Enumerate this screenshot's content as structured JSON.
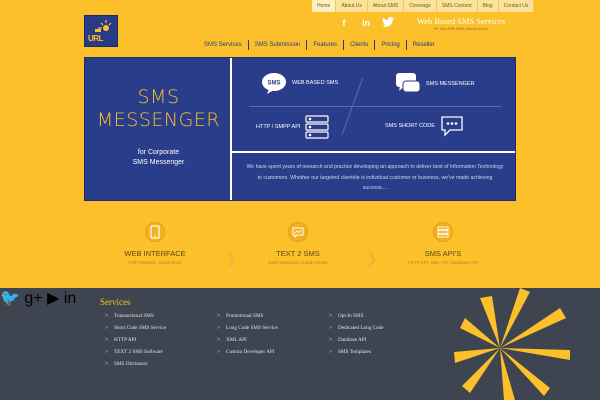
{
  "top_nav": [
    "Home",
    "About Us",
    "About SMS",
    "Coverage",
    "SMS Content",
    "Blog",
    "Contact Us"
  ],
  "logo": {
    "text": "URL"
  },
  "brand": {
    "title": "Web Based SMS Services",
    "subtitle": "Ph: 040-4005 6666 | info@url.co.in"
  },
  "main_nav": [
    "SMS Services",
    "SMS Submission",
    "Features",
    "Clients",
    "Pricing",
    "Reseller"
  ],
  "hero": {
    "title_line1": "SMS",
    "title_line2": "MESSENGER",
    "sub_line1": "for Corporate",
    "sub_line2": "SMS Messenger",
    "features": {
      "web_based": "WEB BASED SMS",
      "messenger": "SMS MESSENGER",
      "http_api": "HTTP / SMPP API",
      "shortcode": "SMS SHORT CODE"
    },
    "description": "We have spent years of research and practice developing an approach to deliver best of Information Technology to customers. Whether our targeted clientèle is individual customer or business, we've made achieving success...."
  },
  "services": [
    {
      "title": "WEB INTERFACE",
      "desc": "Full Featured , Know More"
    },
    {
      "title": "TEXT 2 SMS",
      "desc": "SMS Integration made simple"
    },
    {
      "title": "SMS API'S",
      "desc": "HTTP API, XML API, Database API"
    }
  ],
  "footer": {
    "title": "Services",
    "col1": [
      "Transactional SMS",
      "Short Code SMS Service",
      "HTTP API",
      "TEXT 2 SMS Software",
      "SMS Dictionary"
    ],
    "col2": [
      "Promotional SMS",
      "Long Code SMS Service",
      "XML API",
      "Custom Developer API"
    ],
    "col3": [
      "Opt-In SMS",
      "Dedicated Long Code",
      "Database API",
      "SMS Templates"
    ]
  },
  "colors": {
    "yellow": "#fbc02a",
    "navy": "#2a3d8a",
    "footer": "#3e4550"
  }
}
